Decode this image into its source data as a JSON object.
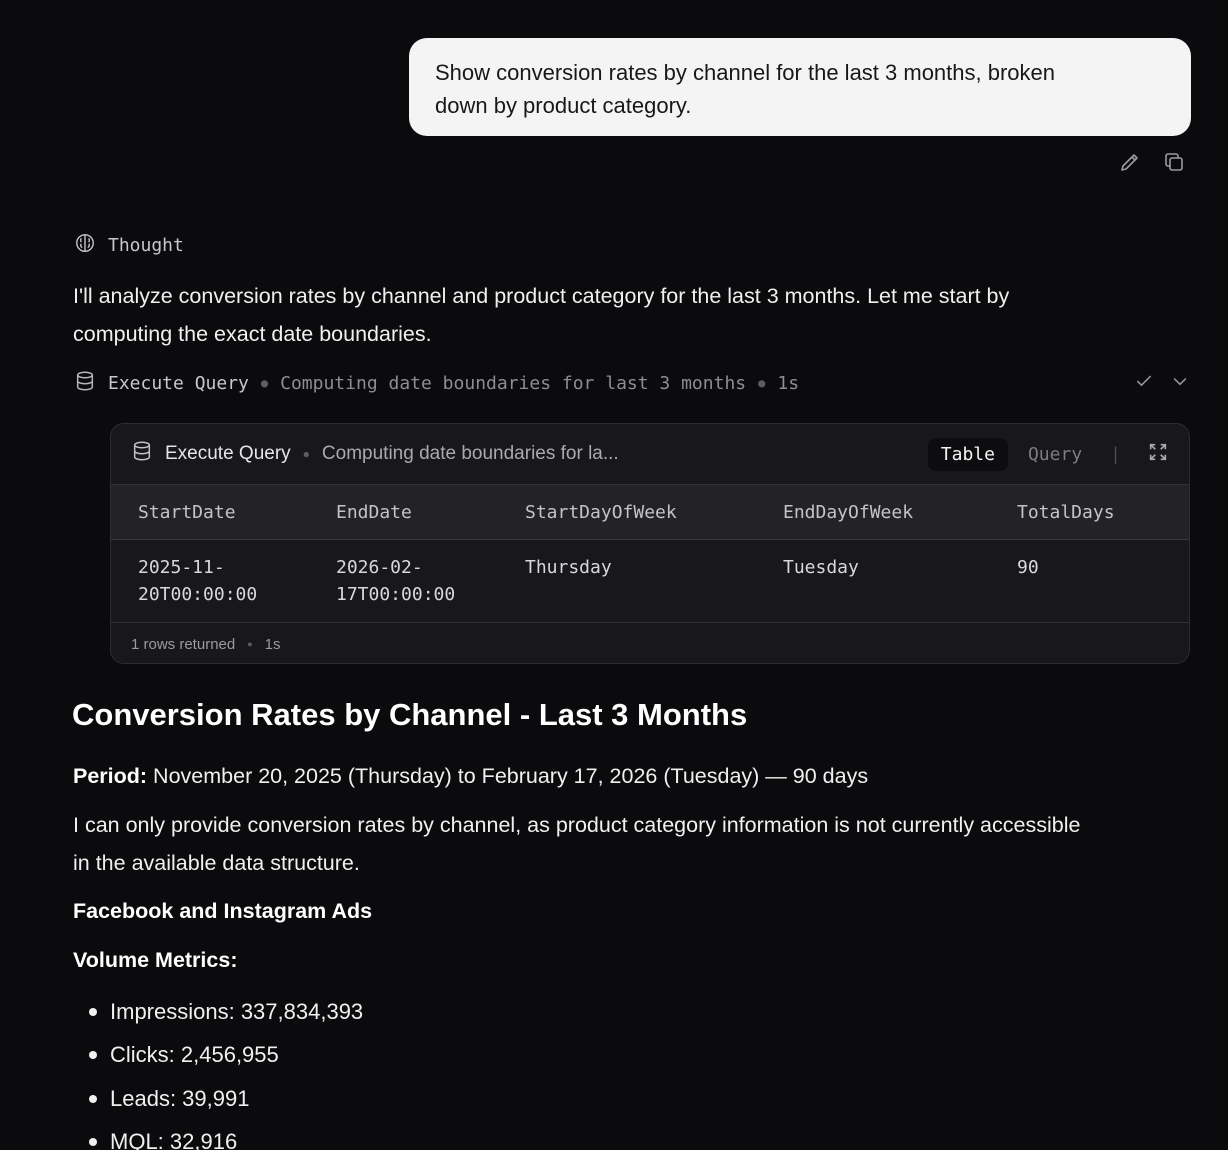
{
  "user_message": {
    "text_line1": "Show conversion rates by channel for the last 3 months, broken",
    "text_line2": "down by product category.",
    "actions": [
      {
        "icon": "edit-icon"
      },
      {
        "icon": "copy-icon"
      }
    ]
  },
  "thought": {
    "icon": "brain-icon",
    "label": "Thought"
  },
  "intro": {
    "line1": "I'll analyze conversion rates by channel and product category for the last 3 months. Let me start by",
    "line2": "computing the exact date boundaries."
  },
  "tool_call": {
    "icon": "database-icon",
    "name": "Execute Query",
    "description": "Computing date boundaries for last 3 months",
    "duration": "1s",
    "status_icon": "check-icon",
    "toggle_icon": "chevron-down-icon"
  },
  "result_card": {
    "title": "Execute Query",
    "description": "Computing date boundaries for la...",
    "view_tabs": {
      "active": "Table",
      "inactive": "Query",
      "separator": "|"
    },
    "expand_icon": "expand-icon",
    "columns": [
      "StartDate",
      "EndDate",
      "StartDayOfWeek",
      "EndDayOfWeek",
      "TotalDays"
    ],
    "rows": [
      {
        "start_line1": "2025-11-",
        "start_line2": "20T00:00:00",
        "end_line1": "2026-02-",
        "end_line2": "17T00:00:00",
        "start_dow": "Thursday",
        "end_dow": "Tuesday",
        "total_days": "90"
      }
    ],
    "footer_rows": "1 rows returned",
    "footer_duration": "1s"
  },
  "report": {
    "heading": "Conversion Rates by Channel - Last 3 Months",
    "period_label": "Period:",
    "period_value": " November 20, 2025 (Thursday) to February 17, 2026 (Tuesday) — 90 days",
    "note_line1": "I can only provide conversion rates by channel, as product category information is not currently accessible",
    "note_line2": "in the available data structure.",
    "channel_heading": "Facebook and Instagram Ads",
    "volume_heading": "Volume Metrics:",
    "metrics": [
      "Impressions: 337,834,393",
      "Clicks: 2,456,955",
      "Leads: 39,991",
      "MQL: 32,916"
    ]
  }
}
